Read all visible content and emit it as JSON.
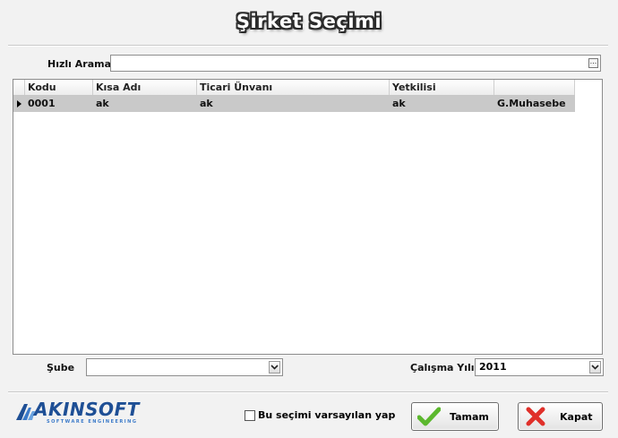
{
  "window": {
    "title": "Şirket Seçimi"
  },
  "search": {
    "label": "Hızlı Arama",
    "value": "",
    "button_label": "..."
  },
  "grid": {
    "columns": [
      "Kodu",
      "Kısa Adı",
      "Ticari Ünvanı",
      "Yetkilisi",
      ""
    ],
    "rows": [
      {
        "kodu": "0001",
        "kisa_adi": "ak",
        "ticari_unvani": "ak",
        "yetkilisi": "ak",
        "extra": "G.Muhasebe"
      }
    ]
  },
  "sube": {
    "label": "Şube",
    "value": ""
  },
  "calisma_yili": {
    "label": "Çalışma Yılı",
    "value": "2011"
  },
  "footer": {
    "logo_text": "AKINSOFT",
    "logo_subtext": "SOFTWARE ENGINEERING",
    "default_checkbox_label": "Bu seçimi varsayılan yap",
    "default_checked": false,
    "ok_label": "Tamam",
    "close_label": "Kapat"
  },
  "colors": {
    "selected_row": "#c9c9c9",
    "ok_icon": "#5cb82e",
    "close_icon": "#e0302a",
    "logo": "#1e4f95"
  },
  "icons": {
    "ok": "checkmark-icon",
    "close": "x-icon",
    "dropdown": "chevron-down-icon"
  }
}
